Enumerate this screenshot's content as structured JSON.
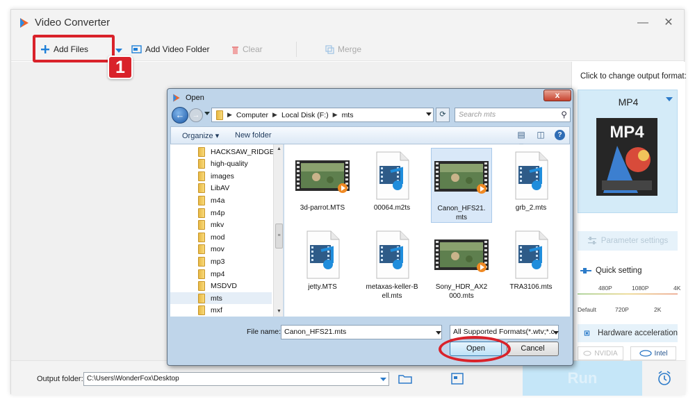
{
  "app": {
    "title": "Video Converter",
    "minimize": "—",
    "close": "✕"
  },
  "toolbar": {
    "add_files": "Add Files",
    "add_video_folder": "Add Video Folder",
    "clear": "Clear",
    "merge": "Merge"
  },
  "callout": {
    "step": "1"
  },
  "right_panel": {
    "heading": "Click to change output format:",
    "format": "MP4",
    "thumb_label": "MP4",
    "parameter_settings": "Parameter settings",
    "quick_setting": "Quick setting",
    "res_top": [
      "480P",
      "1080P",
      "4K"
    ],
    "res_bottom": [
      "Default",
      "720P",
      "2K"
    ],
    "hardware_acceleration": "Hardware acceleration",
    "nvidia": "NVIDIA",
    "intel": "Intel"
  },
  "bottom": {
    "output_folder_label": "Output folder:",
    "output_folder_value": "C:\\Users\\WonderFox\\Desktop",
    "run": "Run"
  },
  "dialog": {
    "title": "Open",
    "close": "x",
    "breadcrumb": [
      "Computer",
      "Local Disk (F:)",
      "mts"
    ],
    "search_placeholder": "Search mts",
    "organize": "Organize ▾",
    "new_folder": "New folder",
    "folders": [
      "HACKSAW_RIDGE",
      "high-quality",
      "images",
      "LibAV",
      "m4a",
      "m4p",
      "mkv",
      "mod",
      "mov",
      "mp3",
      "mp4",
      "MSDVD",
      "mts",
      "mxf"
    ],
    "selected_folder": "mts",
    "files": [
      {
        "name": "3d-parrot.MTS",
        "thumb": "video-thumb"
      },
      {
        "name": "00064.m2ts",
        "thumb": "generic-video"
      },
      {
        "name": "Canon_HFS21.mts",
        "thumb": "video-thumb"
      },
      {
        "name": "grb_2.mts",
        "thumb": "generic-video"
      },
      {
        "name": "jetty.MTS",
        "thumb": "generic-video"
      },
      {
        "name": "metaxas-keller-Bell.mts",
        "thumb": "generic-video"
      },
      {
        "name": "Sony_HDR_AX2000.mts",
        "thumb": "video-thumb"
      },
      {
        "name": "TRA3106.mts",
        "thumb": "generic-video"
      }
    ],
    "selected_file": "Canon_HFS21.mts",
    "file_name_label": "File name:",
    "file_name_value": "Canon_HFS21.mts",
    "filter_value": "All Supported Formats(*.wtv;*.c",
    "open": "Open",
    "cancel": "Cancel"
  },
  "colors": {
    "callout_red": "#d9222a",
    "accent_blue": "#2c7bc9",
    "format_card": "#d4ebf8",
    "run_button": "#c5e6f8"
  }
}
